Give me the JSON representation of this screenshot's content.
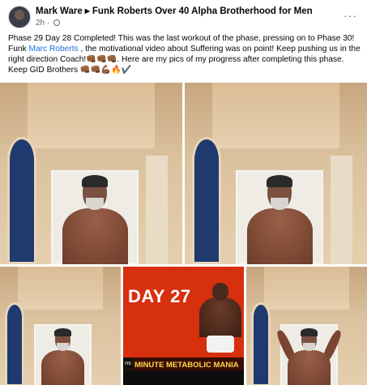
{
  "post": {
    "author": "Mark Ware",
    "group": "Funk Roberts Over 40 Alpha Brotherhood for Men",
    "time": "2h",
    "more_label": "···",
    "text_part1": "Phase 29 Day 28 Completed! This was the last workout of the phase, pressing on to Phase 30! Funk ",
    "mention": "Marc Roberts",
    "text_part2": " , the motivational video about Suffering was on point! Keep pushing us in the right direction Coach!👊🏾👊🏾👊🏾. Here are my pics of my progress after completing this phase. Keep GID Brothers 👊🏾👊🏾💪🏾🔥✔️"
  },
  "photos": {
    "promo_title": "DAY 27",
    "promo_subtitle": "MINUTE METABOLIC MANIA",
    "promo_logo": "ns"
  },
  "icons": {
    "globe": "globe-icon",
    "more": "more-options-icon",
    "arrow": "caret-right-icon"
  },
  "colors": {
    "mention": "#216fdb",
    "promo_bg": "#d7300f",
    "promo_sub": "#ffd84d"
  }
}
